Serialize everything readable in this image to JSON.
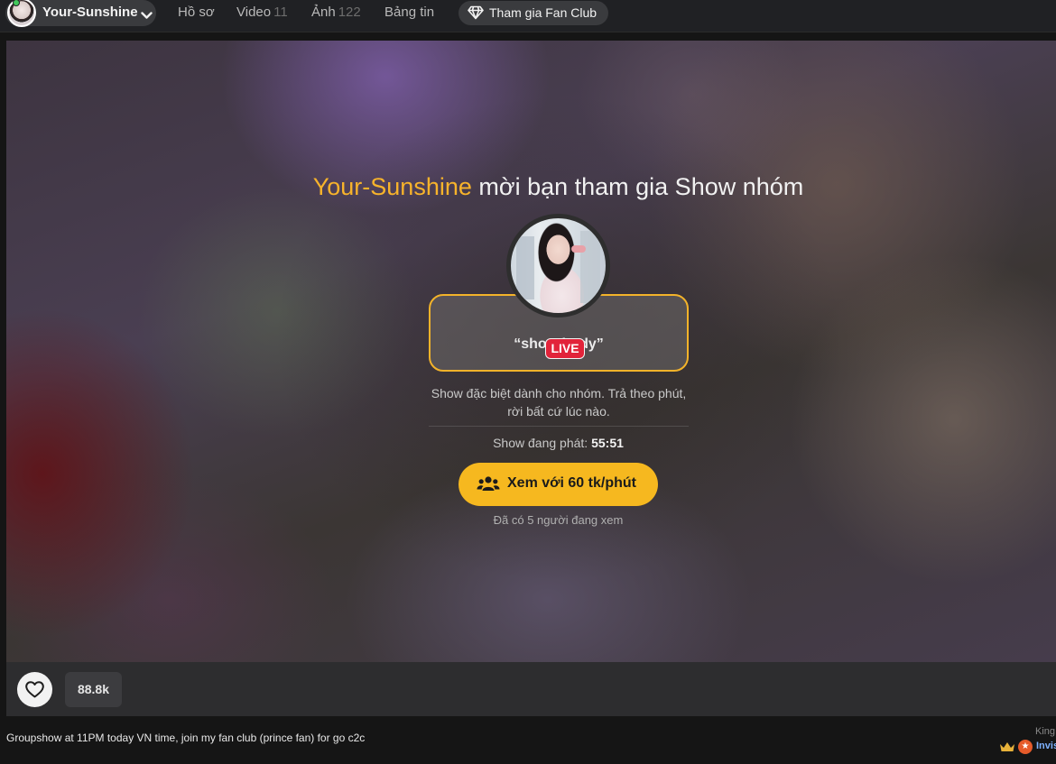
{
  "nav": {
    "username": "Your-Sunshine",
    "links": [
      {
        "label": "Hồ sơ",
        "count": ""
      },
      {
        "label": "Video",
        "count": "11"
      },
      {
        "label": "Ảnh",
        "count": "122"
      },
      {
        "label": "Bảng tin",
        "count": ""
      }
    ],
    "fanclub_label": "Tham gia Fan Club"
  },
  "invite": {
    "host": "Your-Sunshine",
    "title_rest": " mời bạn tham gia Show nhóm",
    "live_badge": "LIVE",
    "topic": "“show body”",
    "description": "Show đặc biệt dành cho nhóm. Trả theo phút, rời bất cứ lúc nào.",
    "status_label": "Show đang phát:",
    "status_time": "55:51",
    "watch_button": "Xem với 60 tk/phút",
    "viewers": "Đã có 5 người đang xem"
  },
  "actions": {
    "like_count": "88.8k"
  },
  "footer": {
    "message": "Groupshow at 11PM today VN time, join my fan club (prince fan) for go c2c",
    "side_label": "King",
    "side_user": "Invis"
  },
  "colors": {
    "accent": "#f6b81f",
    "live": "#e2233a",
    "highlight_text": "#f7b32b"
  },
  "icons": [
    "chevron-down-icon",
    "diamond-icon",
    "group-icon",
    "heart-icon",
    "crown-icon",
    "star-icon"
  ]
}
